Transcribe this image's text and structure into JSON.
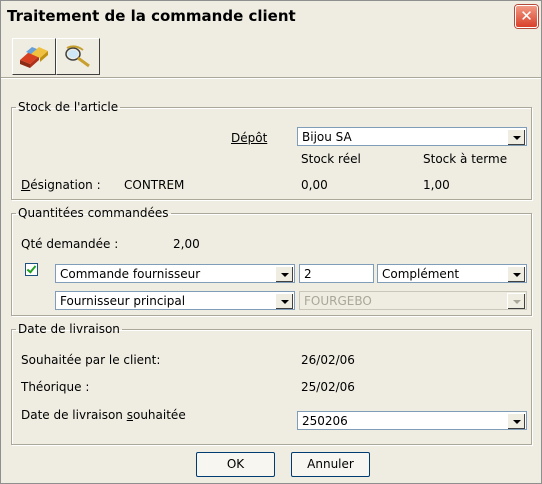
{
  "window": {
    "title": "Traitement de la commande client",
    "close_icon": "close-icon"
  },
  "toolbar": {
    "icons": [
      "process-icon",
      "search-icon"
    ]
  },
  "stock": {
    "legend": "Stock de l'article",
    "depot_label": "Dépôt",
    "depot_value": "Bijou SA",
    "stock_reel_label": "Stock réel",
    "stock_terme_label": "Stock à terme",
    "designation_label": "Désignation :",
    "designation_value": "CONTREM",
    "stock_reel_value": "0,00",
    "stock_terme_value": "1,00"
  },
  "quantites": {
    "legend": "Quantitées commandées",
    "qte_label": "Qté demandée :",
    "qte_value": "2,00",
    "checkbox_checked": true,
    "type_commande": "Commande fournisseur",
    "quantite": "2",
    "complement": "Complément",
    "fournisseur": "Fournisseur principal",
    "code_fournisseur": "FOURGEBO"
  },
  "livraison": {
    "legend": "Date de livraison",
    "souhaitee_client_label": "Souhaitée par le client:",
    "souhaitee_client_value": "26/02/06",
    "theorique_label": "Théorique :",
    "theorique_value": "25/02/06",
    "date_souhaitee_label": "Date de livraison souhaitée",
    "date_souhaitee_value": "250206"
  },
  "buttons": {
    "ok": "OK",
    "annuler": "Annuler"
  }
}
